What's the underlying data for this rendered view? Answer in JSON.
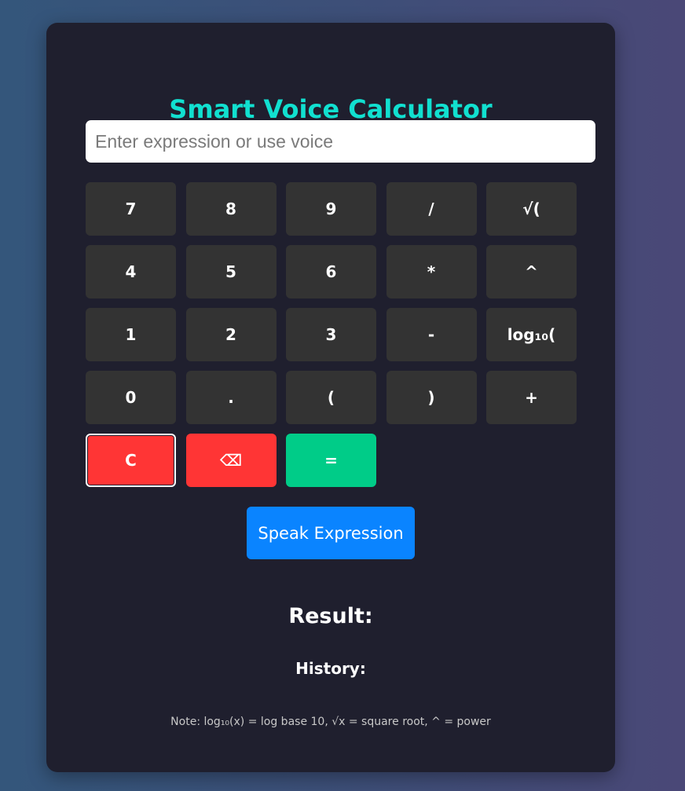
{
  "app": {
    "title": "Smart Voice Calculator"
  },
  "input": {
    "value": "",
    "placeholder": "Enter expression or use voice"
  },
  "keypad": {
    "keys": [
      {
        "label": "7",
        "style": "default"
      },
      {
        "label": "8",
        "style": "default"
      },
      {
        "label": "9",
        "style": "default"
      },
      {
        "label": "/",
        "style": "default"
      },
      {
        "label": "√(",
        "style": "default"
      },
      {
        "label": "4",
        "style": "default"
      },
      {
        "label": "5",
        "style": "default"
      },
      {
        "label": "6",
        "style": "default"
      },
      {
        "label": "*",
        "style": "default"
      },
      {
        "label": "^",
        "style": "default"
      },
      {
        "label": "1",
        "style": "default"
      },
      {
        "label": "2",
        "style": "default"
      },
      {
        "label": "3",
        "style": "default"
      },
      {
        "label": "-",
        "style": "default"
      },
      {
        "label": "log₁₀(",
        "style": "default"
      },
      {
        "label": "0",
        "style": "default"
      },
      {
        "label": ".",
        "style": "default"
      },
      {
        "label": "(",
        "style": "default"
      },
      {
        "label": ")",
        "style": "default"
      },
      {
        "label": "+",
        "style": "default"
      },
      {
        "label": "C",
        "style": "red"
      },
      {
        "label": "⌫",
        "style": "red"
      },
      {
        "label": "=",
        "style": "green"
      }
    ]
  },
  "speak": {
    "label": "Speak Expression"
  },
  "result": {
    "label": "Result:"
  },
  "history": {
    "label": "History:"
  },
  "note": {
    "text": "Note: log₁₀(x) = log base 10, √x = square root, ^ = power"
  },
  "colors": {
    "accent_title": "#11e0d0",
    "key_default": "#333333",
    "key_red": "#ff3535",
    "key_green": "#00cc88",
    "speak_button": "#0a84ff",
    "card_background": "#1f1f2e"
  }
}
